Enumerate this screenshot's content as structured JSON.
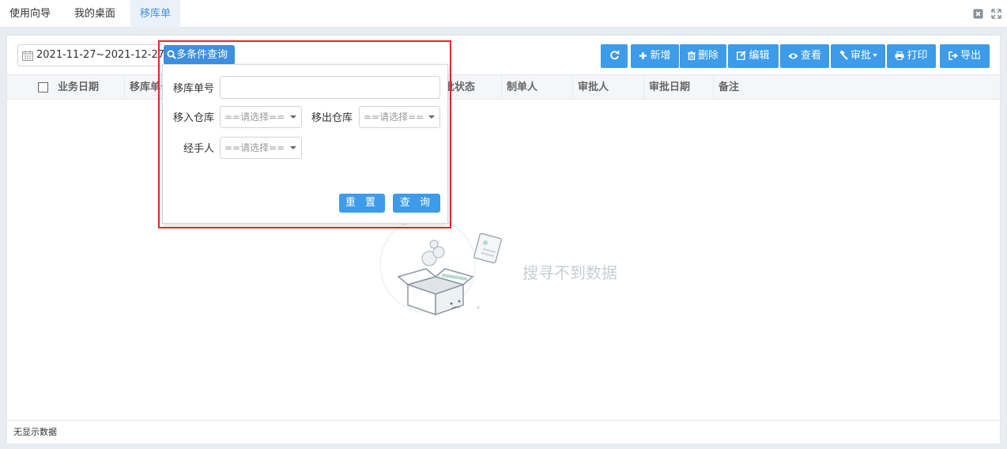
{
  "tabs": [
    {
      "label": "使用向导"
    },
    {
      "label": "我的桌面"
    },
    {
      "label": "移库单"
    }
  ],
  "filter": {
    "date_range": "2021-11-27~2021-12-27",
    "advanced_query_label": "多条件查询"
  },
  "toolbar": {
    "refresh_icon": "refresh-icon",
    "add_label": "新增",
    "delete_label": "删除",
    "edit_label": "编辑",
    "view_label": "查看",
    "approve_label": "审批",
    "print_label": "打印",
    "export_label": "导出",
    "accent_color": "#3d9be9"
  },
  "table": {
    "columns": [
      "业务日期",
      "移库单号",
      "批状态",
      "制单人",
      "审批人",
      "审批日期",
      "备注"
    ]
  },
  "empty_state": {
    "message": "搜寻不到数据"
  },
  "footer": {
    "status": "无显示数据"
  },
  "query_popup": {
    "order_no_label": "移库单号",
    "order_no_value": "",
    "in_warehouse_label": "移入仓库",
    "out_warehouse_label": "移出仓库",
    "handler_label": "经手人",
    "select_placeholder": "==请选择==",
    "reset_label": "重 置",
    "query_label": "查 询"
  },
  "highlight_color": "#e12a2a"
}
